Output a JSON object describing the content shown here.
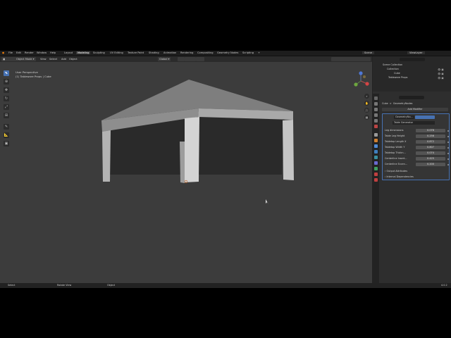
{
  "menu": [
    "File",
    "Edit",
    "Render",
    "Window",
    "Help"
  ],
  "workspaces": [
    "Layout",
    "Modeling",
    "Sculpting",
    "UV Editing",
    "Texture Paint",
    "Shading",
    "Animation",
    "Rendering",
    "Compositing",
    "Geometry Nodes",
    "Scripting"
  ],
  "workspace_add": "+",
  "scene": "Scene",
  "view_layer": "ViewLayer",
  "header": {
    "mode": "Object Mode",
    "menus": [
      "View",
      "Select",
      "Add",
      "Object"
    ],
    "orientation": "Global",
    "options": "Options"
  },
  "viewport": {
    "view_name": "User Perspective",
    "object_info": "(1) Tableware Props | Cube"
  },
  "outliner": {
    "root": "Scene Collection",
    "items": [
      "Collection",
      "Cube",
      "Tableware Props"
    ]
  },
  "properties": {
    "breadcrumb": [
      "Cube",
      "GeometryNodes"
    ],
    "add_modifier": "Add Modifier",
    "modifier_name": "GeometryNo...",
    "node_group": "Table Generator",
    "params": [
      {
        "label": "Leg dimensions",
        "value": "0.076"
      },
      {
        "label": "Table Leg Height",
        "value": "0.256"
      },
      {
        "label": "Tabletop Length X",
        "value": "0.872"
      },
      {
        "label": "Tabletop Width Y",
        "value": "0.807"
      },
      {
        "label": "Tabletop Thickn...",
        "value": "0.074"
      },
      {
        "label": "Centerline Insert...",
        "value": "0.425"
      },
      {
        "label": "Centerline Eccen...",
        "value": "0.200"
      }
    ],
    "sections": [
      "Output Attributes",
      "Internal Dependencies"
    ]
  },
  "status": {
    "select": "Select",
    "rotate": "Rotate View",
    "object": "Object",
    "version": "4.0.2"
  },
  "colors": {
    "accent": "#4772b3",
    "header": "#2b2b2b",
    "viewport": "#3c3c3c",
    "panel": "#2e2e2e"
  }
}
